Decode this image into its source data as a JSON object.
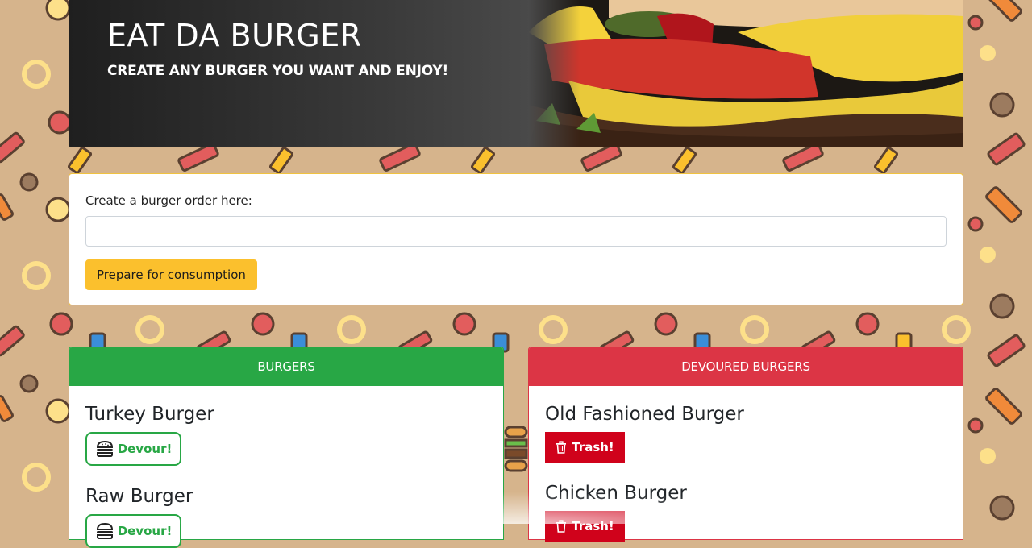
{
  "hero": {
    "title": "EAT DA BURGER",
    "subtitle": "CREATE ANY BURGER YOU WANT AND ENJOY!"
  },
  "form": {
    "label": "Create a burger order here:",
    "input_value": "",
    "input_placeholder": "",
    "submit_label": "Prepare for consumption"
  },
  "burgers": {
    "header": "BURGERS",
    "action_label": "Devour!",
    "action_icon": "burger-icon",
    "items": [
      "Turkey Burger",
      "Raw Burger"
    ]
  },
  "devoured": {
    "header": "DEVOURED BURGERS",
    "action_label": "Trash!",
    "action_icon": "trash-icon",
    "items": [
      "Old Fashioned Burger",
      "Chicken Burger"
    ]
  },
  "colors": {
    "background": "#d6b48c",
    "success": "#28a745",
    "danger": "#dc3545",
    "trash": "#d0021b",
    "accent": "#fbc02d"
  }
}
